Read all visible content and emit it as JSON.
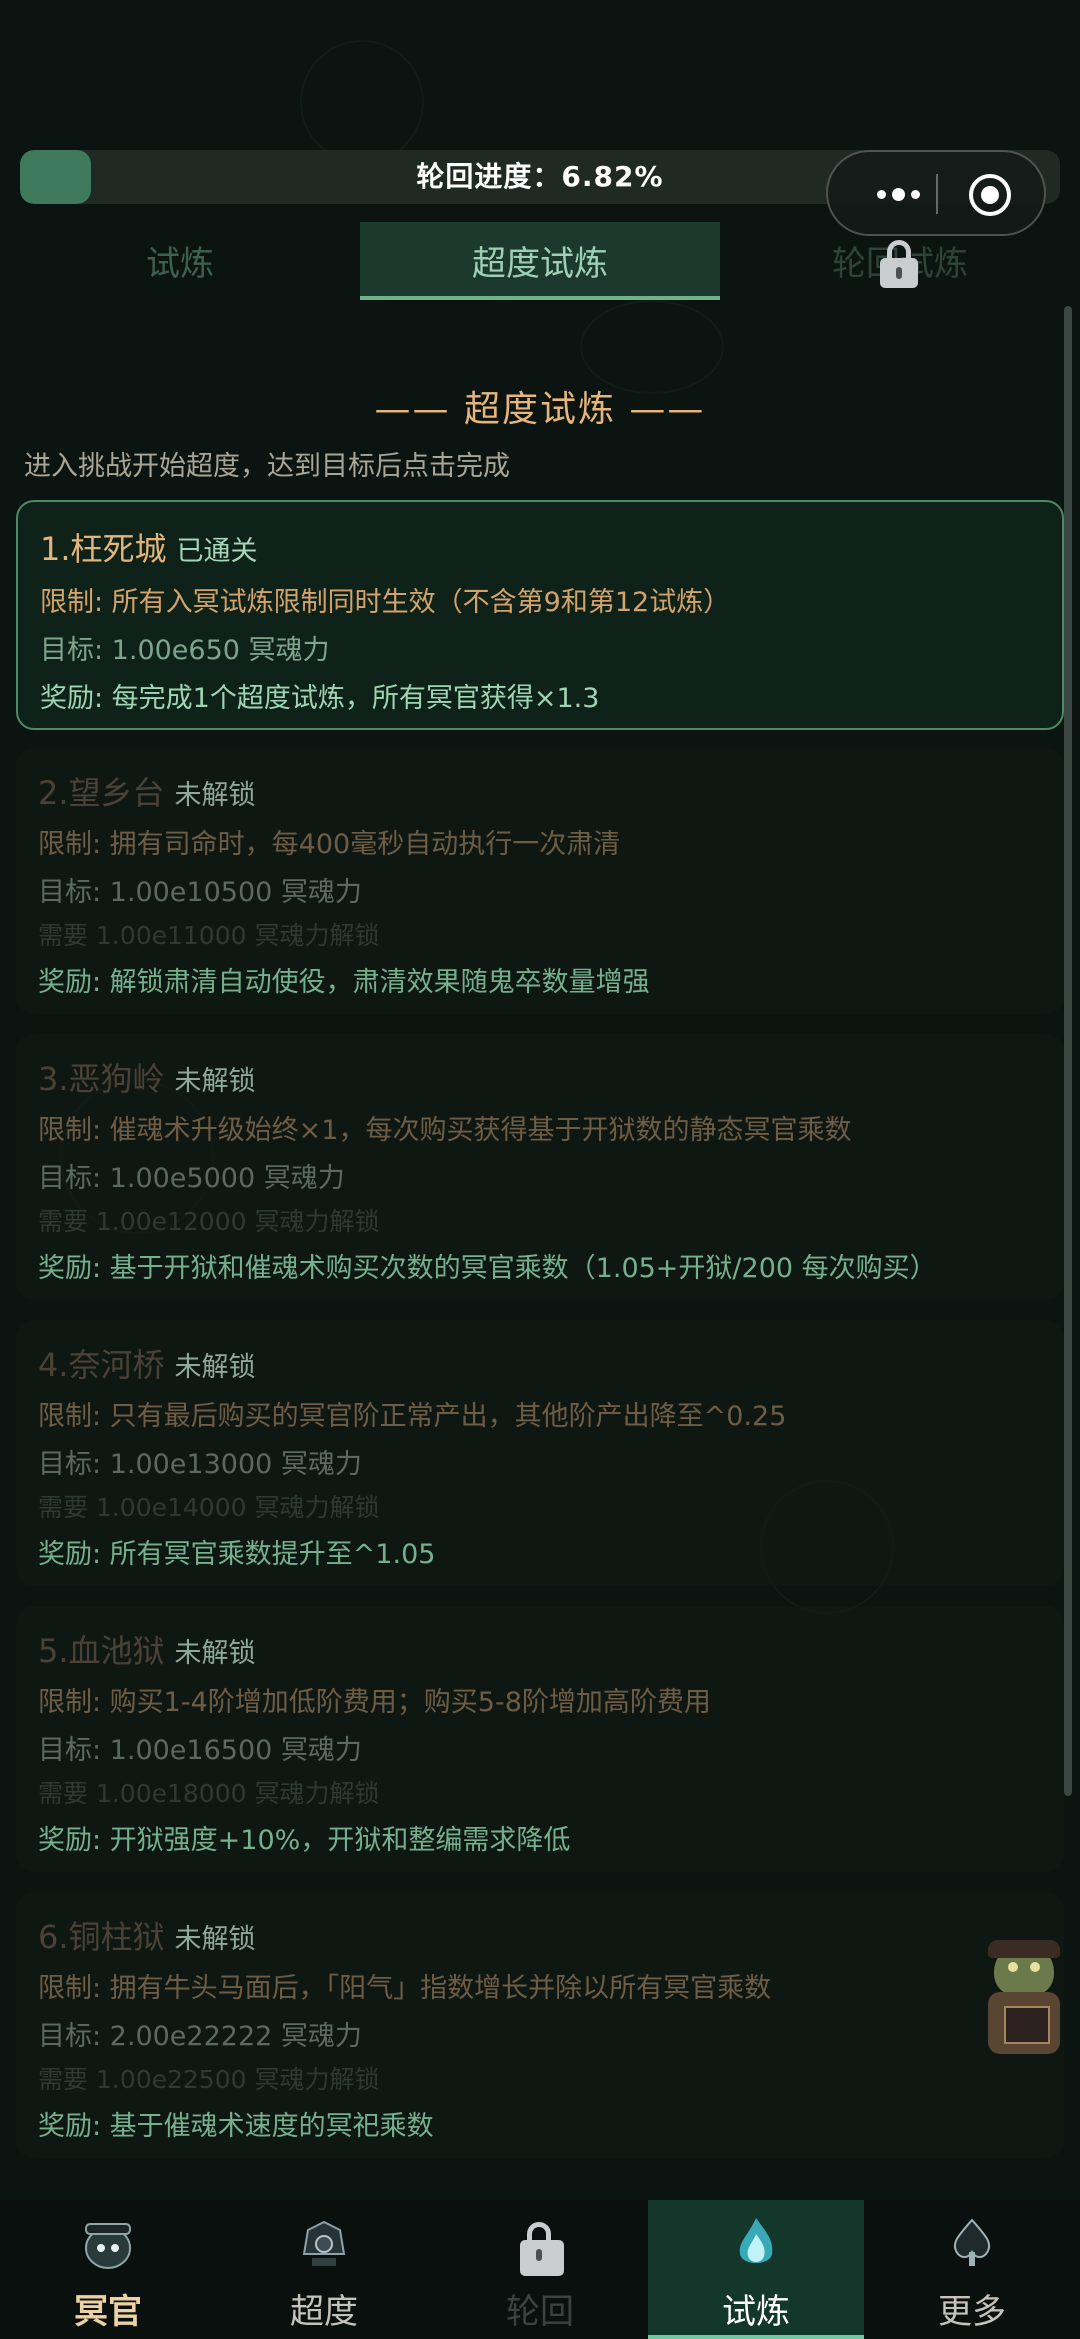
{
  "progress": {
    "label": "轮回进度：6.82%",
    "fraction": 0.0682
  },
  "tabs": [
    {
      "label": "试炼"
    },
    {
      "label": "超度试炼"
    },
    {
      "label": "轮回试炼"
    }
  ],
  "section": {
    "title": "—— 超度试炼 ——",
    "intro": "进入挑战开始超度，达到目标后点击完成"
  },
  "trials": [
    {
      "name": "1.枉死城",
      "status": "已通关",
      "limit": "限制: 所有入冥试炼限制同时生效（不含第9和第12试炼）",
      "target": "目标: 1.00e650 冥魂力",
      "reward": "奖励: 每完成1个超度试炼，所有冥官获得×1.3"
    },
    {
      "name": "2.望乡台",
      "status": "未解锁",
      "limit": "限制: 拥有司命时，每400毫秒自动执行一次肃清",
      "target": "目标: 1.00e10500 冥魂力",
      "require": "需要 1.00e11000 冥魂力解锁",
      "reward": "奖励: 解锁肃清自动使役，肃清效果随鬼卒数量增强"
    },
    {
      "name": "3.恶狗岭",
      "status": "未解锁",
      "limit": "限制: 催魂术升级始终×1，每次购买获得基于开狱数的静态冥官乘数",
      "target": "目标: 1.00e5000 冥魂力",
      "require": "需要 1.00e12000 冥魂力解锁",
      "reward": "奖励: 基于开狱和催魂术购买次数的冥官乘数（1.05+开狱/200 每次购买）"
    },
    {
      "name": "4.奈河桥",
      "status": "未解锁",
      "limit": "限制: 只有最后购买的冥官阶正常产出，其他阶产出降至^0.25",
      "target": "目标: 1.00e13000 冥魂力",
      "require": "需要 1.00e14000 冥魂力解锁",
      "reward": "奖励: 所有冥官乘数提升至^1.05"
    },
    {
      "name": "5.血池狱",
      "status": "未解锁",
      "limit": "限制: 购买1-4阶增加低阶费用；购买5-8阶增加高阶费用",
      "target": "目标: 1.00e16500 冥魂力",
      "require": "需要 1.00e18000 冥魂力解锁",
      "reward": "奖励: 开狱强度+10%，开狱和整编需求降低"
    },
    {
      "name": "6.铜柱狱",
      "status": "未解锁",
      "limit": "限制: 拥有牛头马面后，「阳气」指数增长并除以所有冥官乘数",
      "target": "目标: 2.00e22222 冥魂力",
      "require": "需要 1.00e22500 冥魂力解锁",
      "reward": "奖励: 基于催魂术速度的冥祀乘数"
    }
  ],
  "nav": [
    {
      "label": "冥官",
      "icon": "ghost-official-icon"
    },
    {
      "label": "超度",
      "icon": "ghost-helmet-icon"
    },
    {
      "label": "轮回",
      "icon": "lock-icon"
    },
    {
      "label": "试炼",
      "icon": "blue-flame-icon"
    },
    {
      "label": "更多",
      "icon": "spade-emblem-icon"
    }
  ],
  "colors": {
    "background": "#0b1410",
    "accent_green": "#6fb28e",
    "title_orange": "#e6b579",
    "completed_border": "#4c8a68"
  }
}
